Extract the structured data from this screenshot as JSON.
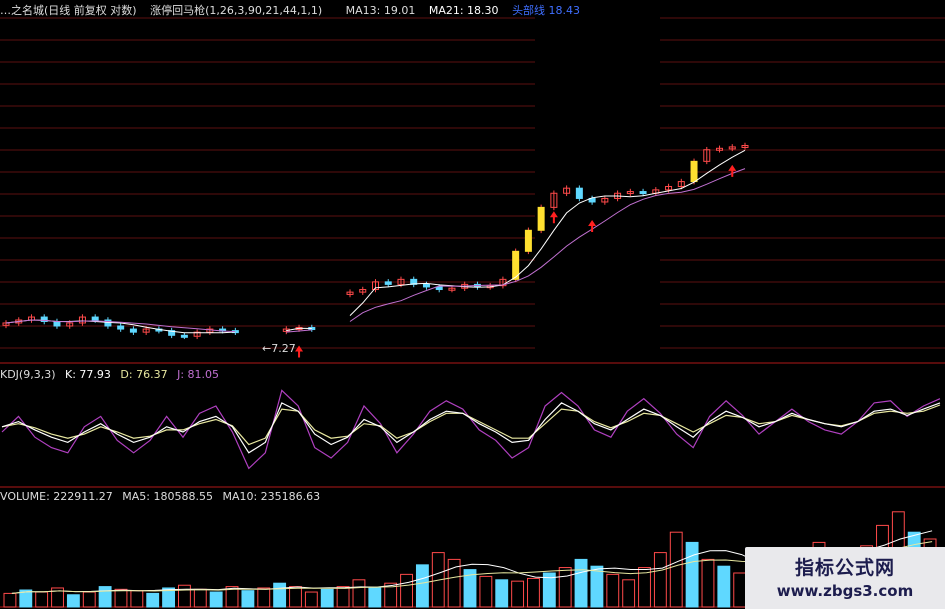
{
  "main_header": {
    "title": "…之名城(日线 前复权 对数)",
    "indicator": "涨停回马枪(1,26,3,90,21,44,1,1)",
    "ma13": "MA13: 19.01",
    "ma21": "MA21: 18.30",
    "extra": "头部线 18.43"
  },
  "kdj_header": {
    "name": "KDJ(9,3,3)",
    "k": "K: 77.93",
    "d": "D: 76.37",
    "j": "J: 81.05"
  },
  "vol_header": {
    "name": "VOLUME: 222911.27",
    "ma5": "MA5: 180588.55",
    "ma10": "MA10: 235186.63"
  },
  "low_label": "←7.27",
  "watermark": {
    "line1": "指标公式网",
    "line2": "www.zbgs3.com"
  },
  "colors": {
    "up": "#ff4a4a",
    "down": "#5fd8ff",
    "signal": "#ffe030",
    "ma_white": "#ffffff",
    "ma_purple": "#c070d0",
    "grid": "#7a1414",
    "k_line": "#ffffff",
    "d_line": "#e8e8a0",
    "j_line": "#b040c0"
  },
  "chart_data": {
    "type": "candlestick",
    "price_close_path": [
      7.7,
      7.8,
      7.9,
      7.75,
      7.6,
      7.7,
      7.9,
      7.8,
      7.6,
      7.5,
      7.4,
      7.5,
      7.45,
      7.3,
      7.27,
      7.4,
      7.5,
      7.45,
      7.4,
      null,
      null,
      null,
      7.5,
      7.55,
      7.5,
      null,
      null,
      8.8,
      8.9,
      9.2,
      9.1,
      9.3,
      9.1,
      9.0,
      8.9,
      8.95,
      9.1,
      9.0,
      9.05,
      9.3,
      10.5,
      11.5,
      12.7,
      13.5,
      13.8,
      13.2,
      13.0,
      13.2,
      13.5,
      13.6,
      13.5,
      13.7,
      13.9,
      14.2,
      15.5,
      16.3,
      16.4,
      16.5,
      16.6
    ],
    "arrows_at": [
      23,
      43,
      46,
      57
    ],
    "kdj": {
      "k": [
        55,
        60,
        52,
        45,
        40,
        50,
        58,
        48,
        40,
        45,
        55,
        50,
        60,
        65,
        55,
        30,
        40,
        78,
        70,
        48,
        38,
        45,
        62,
        55,
        40,
        50,
        62,
        70,
        68,
        58,
        50,
        40,
        42,
        62,
        78,
        70,
        58,
        52,
        62,
        72,
        66,
        55,
        45,
        60,
        70,
        64,
        55,
        60,
        68,
        62,
        58,
        55,
        60,
        70,
        72,
        66,
        72,
        78
      ],
      "d": [
        55,
        58,
        54,
        48,
        44,
        48,
        55,
        50,
        44,
        46,
        52,
        52,
        58,
        62,
        56,
        38,
        44,
        72,
        70,
        52,
        44,
        46,
        58,
        56,
        44,
        50,
        60,
        68,
        68,
        60,
        52,
        44,
        44,
        58,
        72,
        70,
        60,
        54,
        60,
        68,
        66,
        58,
        50,
        58,
        66,
        64,
        58,
        60,
        66,
        62,
        58,
        56,
        60,
        68,
        70,
        68,
        70,
        76
      ],
      "j": [
        50,
        65,
        45,
        35,
        30,
        55,
        65,
        42,
        30,
        42,
        65,
        45,
        68,
        75,
        50,
        15,
        30,
        90,
        75,
        35,
        25,
        40,
        75,
        58,
        30,
        48,
        70,
        80,
        72,
        52,
        42,
        25,
        35,
        75,
        88,
        75,
        52,
        45,
        70,
        82,
        68,
        48,
        35,
        65,
        80,
        66,
        48,
        60,
        72,
        60,
        52,
        48,
        60,
        78,
        80,
        65,
        75,
        82
      ]
    },
    "volume": [
      20,
      25,
      22,
      28,
      18,
      22,
      30,
      26,
      24,
      20,
      28,
      32,
      26,
      22,
      30,
      24,
      28,
      35,
      30,
      22,
      26,
      30,
      40,
      28,
      35,
      48,
      62,
      80,
      70,
      55,
      45,
      40,
      38,
      42,
      50,
      58,
      70,
      60,
      48,
      40,
      58,
      80,
      110,
      95,
      70,
      60,
      50,
      55,
      62,
      72,
      85,
      95,
      80,
      70,
      90,
      120,
      140,
      110,
      100
    ],
    "vol_up": [
      1,
      0,
      1,
      1,
      0,
      1,
      0,
      1,
      1,
      0,
      0,
      1,
      1,
      0,
      1,
      0,
      1,
      0,
      1,
      1,
      0,
      1,
      1,
      0,
      1,
      1,
      0,
      1,
      1,
      0,
      1,
      0,
      1,
      1,
      0,
      1,
      0,
      0,
      1,
      1,
      1,
      1,
      1,
      0,
      1,
      0,
      1,
      1,
      0,
      1,
      0,
      1,
      0,
      1,
      1,
      1,
      1,
      0,
      1
    ],
    "ylabel_low": "7.27"
  }
}
